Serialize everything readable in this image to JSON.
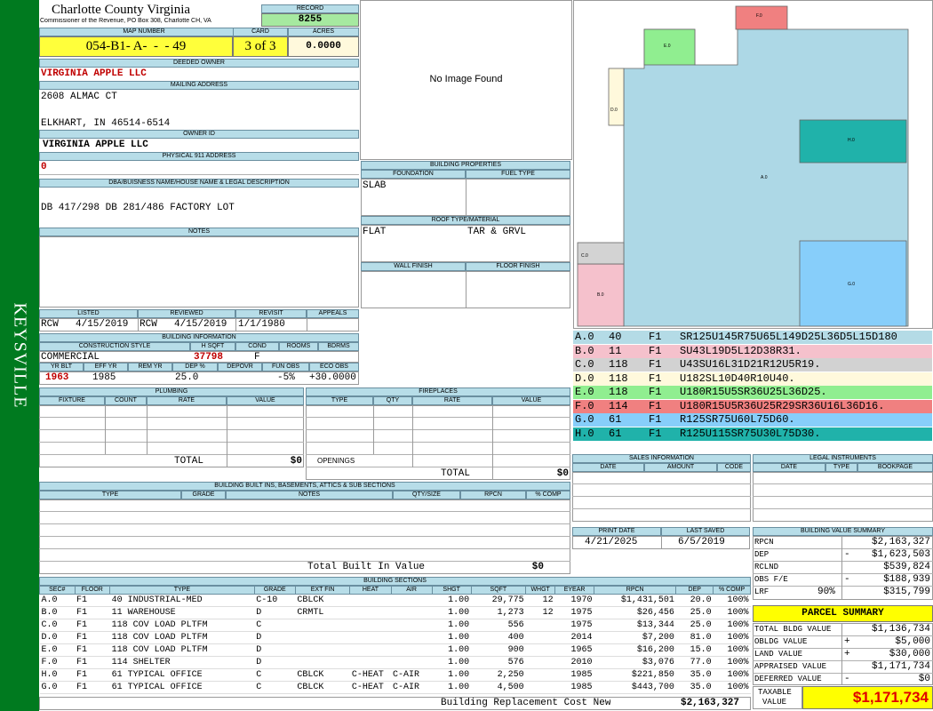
{
  "sidebar": {
    "label": "KEYSVILLE"
  },
  "header": {
    "county": "Charlotte County Virginia",
    "commissioner": "Commissioner of the Revenue, PO Box 308, Charlotte CH, VA",
    "record_label": "RECORD",
    "record": "8255",
    "map_number_label": "MAP NUMBER",
    "map_number": "054-B1- A-  -  - 49",
    "card_label": "CARD",
    "card": "3 of 3",
    "acres_label": "ACRES",
    "acres": "0.0000"
  },
  "owner": {
    "deeded_owner_label": "DEEDED OWNER",
    "deeded_owner": "VIRGINIA APPLE LLC",
    "mailing_label": "MAILING ADDRESS",
    "address1": "2608 ALMAC CT",
    "address2": "ELKHART, IN 46514-6514",
    "owner_id_label": "OWNER ID",
    "owner_id": "VIRGINIA APPLE LLC",
    "physical_label": "PHYSICAL 911 ADDRESS",
    "physical": "0",
    "dba_label": "DBA/BUISNESS NAME/HOUSE NAME & LEGAL DESCRIPTION",
    "legal": "DB 417/298 DB 281/486 FACTORY LOT",
    "notes_label": "NOTES"
  },
  "image": {
    "no_image": "No Image Found"
  },
  "building_properties": {
    "title": "BUILDING PROPERTIES",
    "foundation_label": "FOUNDATION",
    "foundation": "SLAB",
    "fuel_label": "FUEL TYPE",
    "roof_label": "ROOF TYPE/MATERIAL",
    "roof_type": "FLAT",
    "roof_material": "TAR & GRVL",
    "wall_label": "WALL FINISH",
    "floor_label": "FLOOR FINISH"
  },
  "listing": {
    "listed_label": "LISTED",
    "listed_by": "RCW",
    "listed_date": "4/15/2019",
    "reviewed_label": "REVIEWED",
    "reviewed_by": "RCW",
    "reviewed_date": "4/15/2019",
    "revisit_label": "REVISIT",
    "revisit_date": "1/1/1980",
    "appeals_label": "APPEALS"
  },
  "building_info": {
    "title": "BUILDING INFORMATION",
    "construction_label": "CONSTRUCTION STYLE",
    "construction": "COMMERCIAL",
    "hsqft_label": "H SQFT",
    "hsqft": "37798",
    "cond_label": "COND",
    "cond": "F",
    "rooms_label": "ROOMS",
    "bdrms_label": "BDRMS",
    "yrblt_label": "YR BLT",
    "yrblt": "1963",
    "effyr_label": "EFF YR",
    "effyr": "1985",
    "remyr_label": "REM YR",
    "dep_label": "DEP %",
    "dep": "25.0",
    "depovr_label": "DEPOVR",
    "funobs_label": "FUN OBS",
    "funobs": "-5%",
    "ecoobs_label": "ECO OBS",
    "ecoobs": "+30.0000"
  },
  "plumbing": {
    "title": "PLUMBING",
    "fixture": "FIXTURE",
    "count": "COUNT",
    "rate": "RATE",
    "value": "VALUE",
    "total_label": "TOTAL",
    "total": "$0"
  },
  "fireplaces": {
    "title": "FIREPLACES",
    "type": "TYPE",
    "qty": "QTY",
    "rate": "RATE",
    "value": "VALUE",
    "openings": "OPENINGS",
    "total_label": "TOTAL",
    "total": "$0"
  },
  "built_ins": {
    "title": "BUILDING BUILT INS, BASEMENTS, ATTICS & SUB SECTIONS",
    "type": "TYPE",
    "grade": "GRADE",
    "notes": "NOTES",
    "qty": "QTY/SIZE",
    "rpcn": "RPCN",
    "pct": "% COMP",
    "total_label": "Total Built In Value",
    "total": "$0"
  },
  "sketch": {
    "labels": [
      "A.0",
      "B.0",
      "C.0",
      "D.0",
      "E.0",
      "F.0",
      "G.0",
      "H.0"
    ]
  },
  "sketch_sections": [
    {
      "sec": "A.0",
      "code": "40",
      "floor": "F1",
      "path": "SR125U145R75U65L149D25L36D5L15D180",
      "color": "#b4dbe6"
    },
    {
      "sec": "B.0",
      "code": "11",
      "floor": "F1",
      "path": "SU43L19D5L12D38R31.",
      "color": "#f5c1cc"
    },
    {
      "sec": "C.0",
      "code": "118",
      "floor": "F1",
      "path": "U43SU16L31D21R12U5R19.",
      "color": "#d2d2d2"
    },
    {
      "sec": "D.0",
      "code": "118",
      "floor": "F1",
      "path": "U182SL10D40R10U40.",
      "color": "#fff9dc"
    },
    {
      "sec": "E.0",
      "code": "118",
      "floor": "F1",
      "path": "U180R15U5SR36U25L36D25.",
      "color": "#90ee90"
    },
    {
      "sec": "F.0",
      "code": "114",
      "floor": "F1",
      "path": "U180R15U5R36U25R29SR36U16L36D16.",
      "color": "#f08080"
    },
    {
      "sec": "G.0",
      "code": "61",
      "floor": "F1",
      "path": "R125SR75U60L75D60.",
      "color": "#87cefa"
    },
    {
      "sec": "H.0",
      "code": "61",
      "floor": "F1",
      "path": "R125U115SR75U30L75D30.",
      "color": "#20b2aa"
    }
  ],
  "sales": {
    "title": "SALES INFORMATION",
    "date": "DATE",
    "amount": "AMOUNT",
    "code": "CODE"
  },
  "legal_instruments": {
    "title": "LEGAL INSTRUMENTS",
    "date": "DATE",
    "type": "TYPE",
    "bookpage": "BOOKPAGE"
  },
  "print_info": {
    "print_label": "PRINT DATE",
    "print_date": "4/21/2025",
    "saved_label": "LAST SAVED",
    "saved_date": "6/5/2019"
  },
  "value_summary": {
    "title": "BUILDING VALUE SUMMARY",
    "rpcn_label": "RPCN",
    "rpcn": "$2,163,327",
    "dep_label": "DEP",
    "dep_sign": "-",
    "dep": "$1,623,503",
    "rclnd_label": "RCLND",
    "rclnd": "$539,824",
    "obs_label": "OBS F/E",
    "obs_sign": "-",
    "obs": "$188,939",
    "lrf_label": "LRF",
    "lrf_pct": "90%",
    "lrf": "$315,799"
  },
  "parcel_summary": {
    "title": "PARCEL SUMMARY",
    "bldg_label": "TOTAL BLDG VALUE",
    "bldg": "$1,136,734",
    "obldg_label": "OBLDG VALUE",
    "obldg_sign": "+",
    "obldg": "$5,000",
    "land_label": "LAND VALUE",
    "land_sign": "+",
    "land": "$30,000",
    "appraised_label": "APPRAISED VALUE",
    "appraised": "$1,171,734",
    "deferred_label": "DEFERRED VALUE",
    "deferred_sign": "-",
    "deferred": "$0",
    "taxable_label1": "TAXABLE",
    "taxable_label2": "VALUE",
    "taxable": "$1,171,734"
  },
  "sections": {
    "title": "BUILDING SECTIONS",
    "headers": [
      "SEC#",
      "FLOOR",
      "TYPE",
      "GRADE",
      "EXT FIN",
      "HEAT",
      "AIR",
      "SHGT",
      "SQFT",
      "WHGT",
      "EYEAR",
      "RPCN",
      "DEP",
      "% COMP"
    ],
    "rows": [
      [
        "A.0",
        "F1",
        "40 INDUSTRIAL-MED",
        "C-10",
        "CBLCK",
        "",
        "",
        "1.00",
        "29,775",
        "12",
        "1970",
        "$1,431,501",
        "20.0",
        "100%"
      ],
      [
        "B.0",
        "F1",
        "11 WAREHOUSE",
        "D",
        "CRMTL",
        "",
        "",
        "1.00",
        "1,273",
        "12",
        "1975",
        "$26,456",
        "25.0",
        "100%"
      ],
      [
        "C.0",
        "F1",
        "118 COV LOAD PLTFM",
        "C",
        "",
        "",
        "",
        "1.00",
        "556",
        "",
        "1975",
        "$13,344",
        "25.0",
        "100%"
      ],
      [
        "D.0",
        "F1",
        "118 COV LOAD PLTFM",
        "D",
        "",
        "",
        "",
        "1.00",
        "400",
        "",
        "2014",
        "$7,200",
        "81.0",
        "100%"
      ],
      [
        "E.0",
        "F1",
        "118 COV LOAD PLTFM",
        "D",
        "",
        "",
        "",
        "1.00",
        "900",
        "",
        "1965",
        "$16,200",
        "15.0",
        "100%"
      ],
      [
        "F.0",
        "F1",
        "114 SHELTER",
        "D",
        "",
        "",
        "",
        "1.00",
        "576",
        "",
        "2010",
        "$3,076",
        "77.0",
        "100%"
      ],
      [
        "H.0",
        "F1",
        "61 TYPICAL OFFICE",
        "C",
        "CBLCK",
        "C-HEAT",
        "C-AIR",
        "1.00",
        "2,250",
        "",
        "1985",
        "$221,850",
        "35.0",
        "100%"
      ],
      [
        "G.0",
        "F1",
        "61 TYPICAL OFFICE",
        "C",
        "CBLCK",
        "C-HEAT",
        "C-AIR",
        "1.00",
        "4,500",
        "",
        "1985",
        "$443,700",
        "35.0",
        "100%"
      ]
    ],
    "total_label": "Building Replacement Cost New",
    "total": "$2,163,327"
  }
}
